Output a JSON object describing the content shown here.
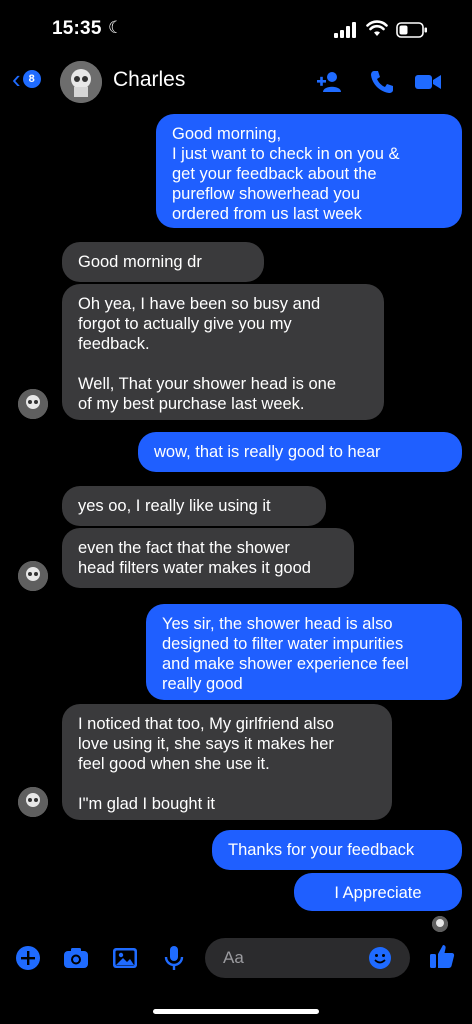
{
  "status": {
    "time": "15:35"
  },
  "header": {
    "back_count": "8",
    "contact_name": "Charles"
  },
  "colors": {
    "accent": "#1f5fff",
    "incoming_bubble": "#3a3a3c",
    "background": "#000000"
  },
  "messages": [
    {
      "dir": "out",
      "text": "Good morning,\nI just want to check in on you &\nget your feedback about the\npureflow showerhead you\nordered from us last week"
    },
    {
      "dir": "in",
      "text": "Good morning dr"
    },
    {
      "dir": "in",
      "text": "Oh yea, I have been so busy and\nforgot to actually give you my\nfeedback.\n\nWell, That your shower head is one\nof my best purchase last week."
    },
    {
      "dir": "out",
      "text": "wow, that is really good to hear"
    },
    {
      "dir": "in",
      "text": "yes oo,  I really like using it"
    },
    {
      "dir": "in",
      "text": "even the fact that the shower\nhead filters water makes it good"
    },
    {
      "dir": "out",
      "text": "Yes sir, the shower head is also\ndesigned to filter water impurities\nand make shower  experience feel\nreally good"
    },
    {
      "dir": "in",
      "text": "I noticed that too, My girlfriend also\nlove using it, she says it makes her\nfeel good when she use it.\n\nI\"m glad I bought it"
    },
    {
      "dir": "out",
      "text": "Thanks for your feedback"
    },
    {
      "dir": "out",
      "text": "I Appreciate"
    }
  ],
  "composer": {
    "placeholder": "Aa"
  },
  "icons": [
    "plus-icon",
    "camera-icon",
    "image-icon",
    "microphone-icon",
    "emoji-icon",
    "thumbs-up-icon",
    "add-person-icon",
    "phone-icon",
    "video-icon"
  ]
}
